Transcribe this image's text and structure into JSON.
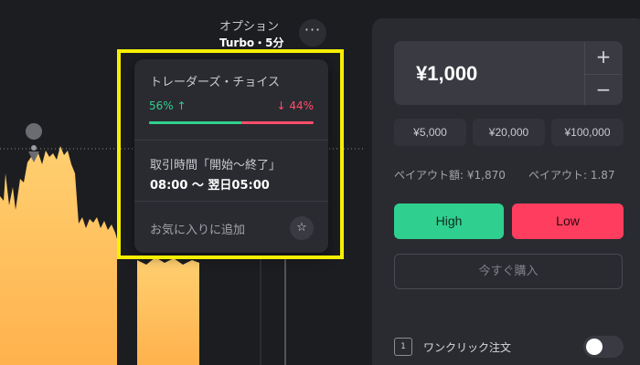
{
  "option": {
    "type_label": "オプション",
    "mode_label": "Turbo・5分"
  },
  "popup": {
    "traders_choice_label": "トレーダーズ・チョイス",
    "up_percent_text": "56% ↑",
    "down_percent_text": "↓ 44%",
    "up_share": 0.56,
    "trading_hours_label": "取引時間「開始〜終了」",
    "trading_hours_value": "08:00 〜 翌日05:00",
    "favorite_label": "お気に入りに追加"
  },
  "panel": {
    "amount": "¥1,000",
    "plus": "+",
    "minus": "−",
    "presets": [
      "¥5,000",
      "¥20,000",
      "¥100,000"
    ],
    "payout_amount": "ペイアウト額: ¥1,870",
    "payout_rate": "ペイアウト: 1.87",
    "high_label": "High",
    "low_label": "Low",
    "buy_now_label": "今すぐ購入",
    "one_click_label": "ワンクリック注文",
    "one_click_icon_text": "1",
    "one_click_enabled": false
  },
  "icons": {
    "more": "ellipsis-icon",
    "favorite": "star-icon",
    "marker": "price-marker-icon",
    "one_click": "one-click-icon"
  },
  "colors": {
    "up": "#2fd08f",
    "down": "#ff3d5e",
    "chart_fill": "#ffc15e",
    "highlight": "#f6ef00"
  }
}
